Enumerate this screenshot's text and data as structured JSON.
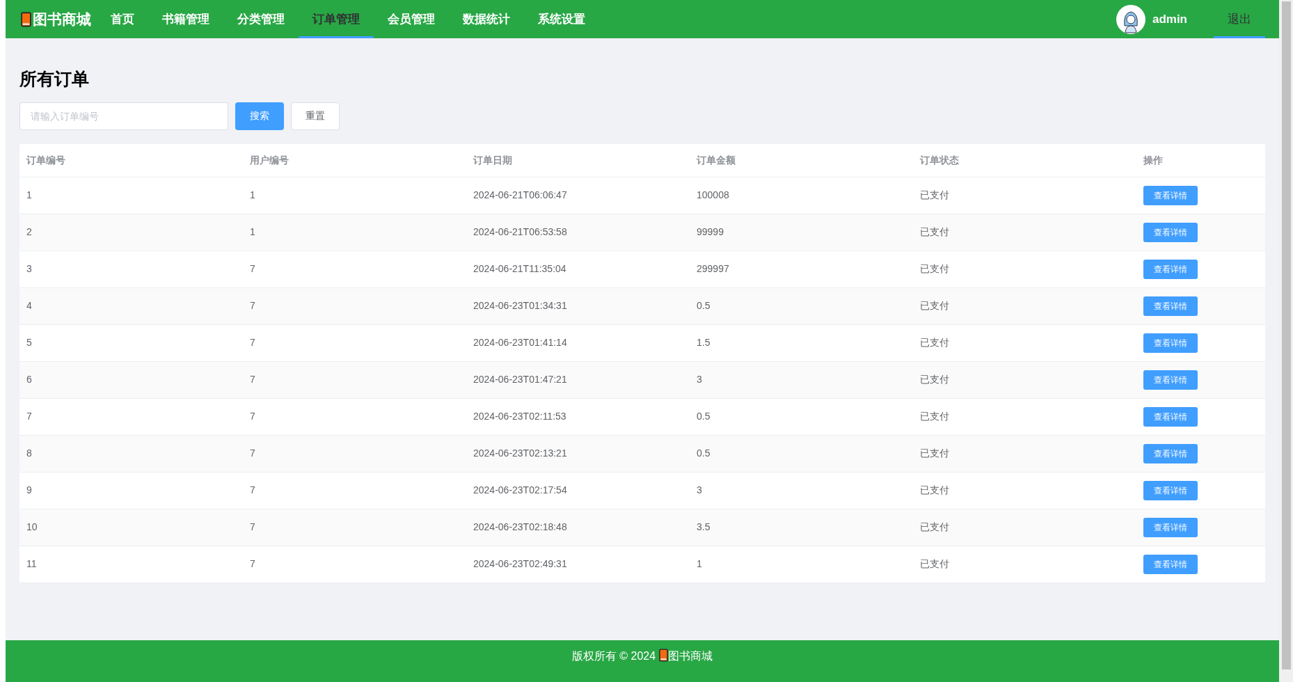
{
  "brand": {
    "name": "图书商城"
  },
  "nav": [
    {
      "label": "首页",
      "selected": false
    },
    {
      "label": "书籍管理",
      "selected": false
    },
    {
      "label": "分类管理",
      "selected": false
    },
    {
      "label": "订单管理",
      "selected": true
    },
    {
      "label": "会员管理",
      "selected": false
    },
    {
      "label": "数据统计",
      "selected": false
    },
    {
      "label": "系统设置",
      "selected": false
    }
  ],
  "user": {
    "name": "admin"
  },
  "logout": {
    "label": "退出",
    "selected": true
  },
  "page_title": "所有订单",
  "search": {
    "placeholder": "请输入订单编号",
    "search_button": "搜索",
    "reset_button": "重置"
  },
  "table": {
    "columns": [
      "订单编号",
      "用户编号",
      "订单日期",
      "订单金额",
      "订单状态",
      "操作"
    ],
    "rows": [
      {
        "cells": [
          "1",
          "1",
          "2024-06-21T06:06:47",
          "100008",
          "已支付"
        ],
        "action": "查看详情"
      },
      {
        "cells": [
          "2",
          "1",
          "2024-06-21T06:53:58",
          "99999",
          "已支付"
        ],
        "action": "查看详情"
      },
      {
        "cells": [
          "3",
          "7",
          "2024-06-21T11:35:04",
          "299997",
          "已支付"
        ],
        "action": "查看详情"
      },
      {
        "cells": [
          "4",
          "7",
          "2024-06-23T01:34:31",
          "0.5",
          "已支付"
        ],
        "action": "查看详情"
      },
      {
        "cells": [
          "5",
          "7",
          "2024-06-23T01:41:14",
          "1.5",
          "已支付"
        ],
        "action": "查看详情"
      },
      {
        "cells": [
          "6",
          "7",
          "2024-06-23T01:47:21",
          "3",
          "已支付"
        ],
        "action": "查看详情"
      },
      {
        "cells": [
          "7",
          "7",
          "2024-06-23T02:11:53",
          "0.5",
          "已支付"
        ],
        "action": "查看详情"
      },
      {
        "cells": [
          "8",
          "7",
          "2024-06-23T02:13:21",
          "0.5",
          "已支付"
        ],
        "action": "查看详情"
      },
      {
        "cells": [
          "9",
          "7",
          "2024-06-23T02:17:54",
          "3",
          "已支付"
        ],
        "action": "查看详情"
      },
      {
        "cells": [
          "10",
          "7",
          "2024-06-23T02:18:48",
          "3.5",
          "已支付"
        ],
        "action": "查看详情"
      },
      {
        "cells": [
          "11",
          "7",
          "2024-06-23T02:49:31",
          "1",
          "已支付"
        ],
        "action": "查看详情"
      }
    ]
  },
  "footer": {
    "copyright": "版权所有 © 2024",
    "brand": "图书商城"
  }
}
